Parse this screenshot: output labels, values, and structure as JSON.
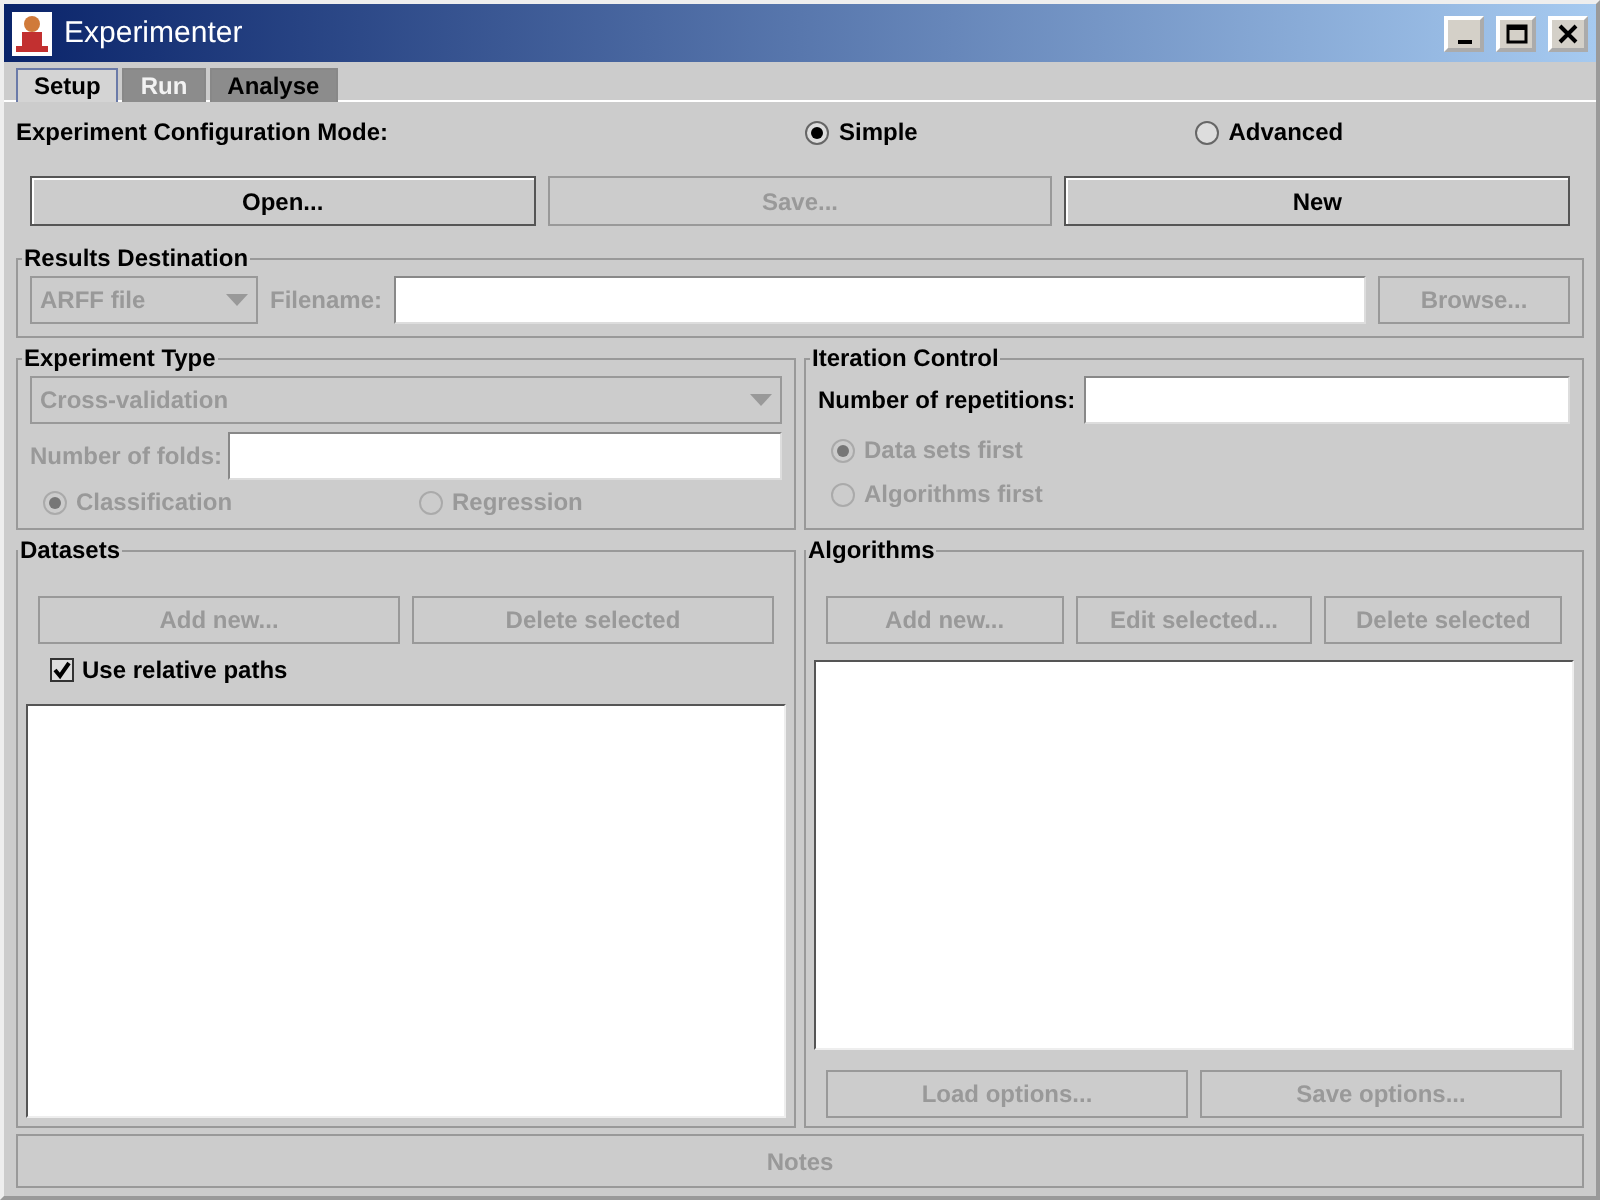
{
  "window": {
    "title": "Experimenter"
  },
  "tabs": [
    {
      "label": "Setup",
      "selected": true,
      "disabled": false
    },
    {
      "label": "Run",
      "selected": false,
      "disabled": true
    },
    {
      "label": "Analyse",
      "selected": false,
      "disabled": false
    }
  ],
  "config_mode": {
    "label": "Experiment Configuration Mode:",
    "options": [
      {
        "label": "Simple",
        "selected": true
      },
      {
        "label": "Advanced",
        "selected": false
      }
    ]
  },
  "file_buttons": [
    {
      "label": "Open...",
      "disabled": false
    },
    {
      "label": "Save...",
      "disabled": true
    },
    {
      "label": "New",
      "disabled": false
    }
  ],
  "results_destination": {
    "title": "Results Destination",
    "disabled": true,
    "type_select": {
      "value": "ARFF file"
    },
    "filename_label": "Filename:",
    "browse_button": {
      "label": "Browse...",
      "disabled": true
    }
  },
  "experiment_type": {
    "title": "Experiment Type",
    "disabled": true,
    "select": {
      "value": "Cross-validation"
    },
    "folds_label": "Number of folds:",
    "options": [
      {
        "label": "Classification",
        "selected": true
      },
      {
        "label": "Regression",
        "selected": false
      }
    ]
  },
  "iteration_control": {
    "title": "Iteration Control",
    "repetitions_label": "Number of repetitions:",
    "options": [
      {
        "label": "Data sets first",
        "selected": true,
        "disabled": true
      },
      {
        "label": "Algorithms first",
        "selected": false,
        "disabled": true
      }
    ]
  },
  "datasets": {
    "title": "Datasets",
    "buttons": [
      {
        "label": "Add new...",
        "disabled": true
      },
      {
        "label": "Delete selected",
        "disabled": true
      }
    ],
    "use_relative_paths": {
      "label": "Use relative paths",
      "checked": true
    }
  },
  "algorithms": {
    "title": "Algorithms",
    "buttons": [
      {
        "label": "Add new...",
        "disabled": true
      },
      {
        "label": "Edit selected...",
        "disabled": true
      },
      {
        "label": "Delete selected",
        "disabled": true
      }
    ],
    "option_buttons": [
      {
        "label": "Load options...",
        "disabled": true
      },
      {
        "label": "Save options...",
        "disabled": true
      }
    ]
  },
  "notes_button": {
    "label": "Notes",
    "disabled": true
  }
}
